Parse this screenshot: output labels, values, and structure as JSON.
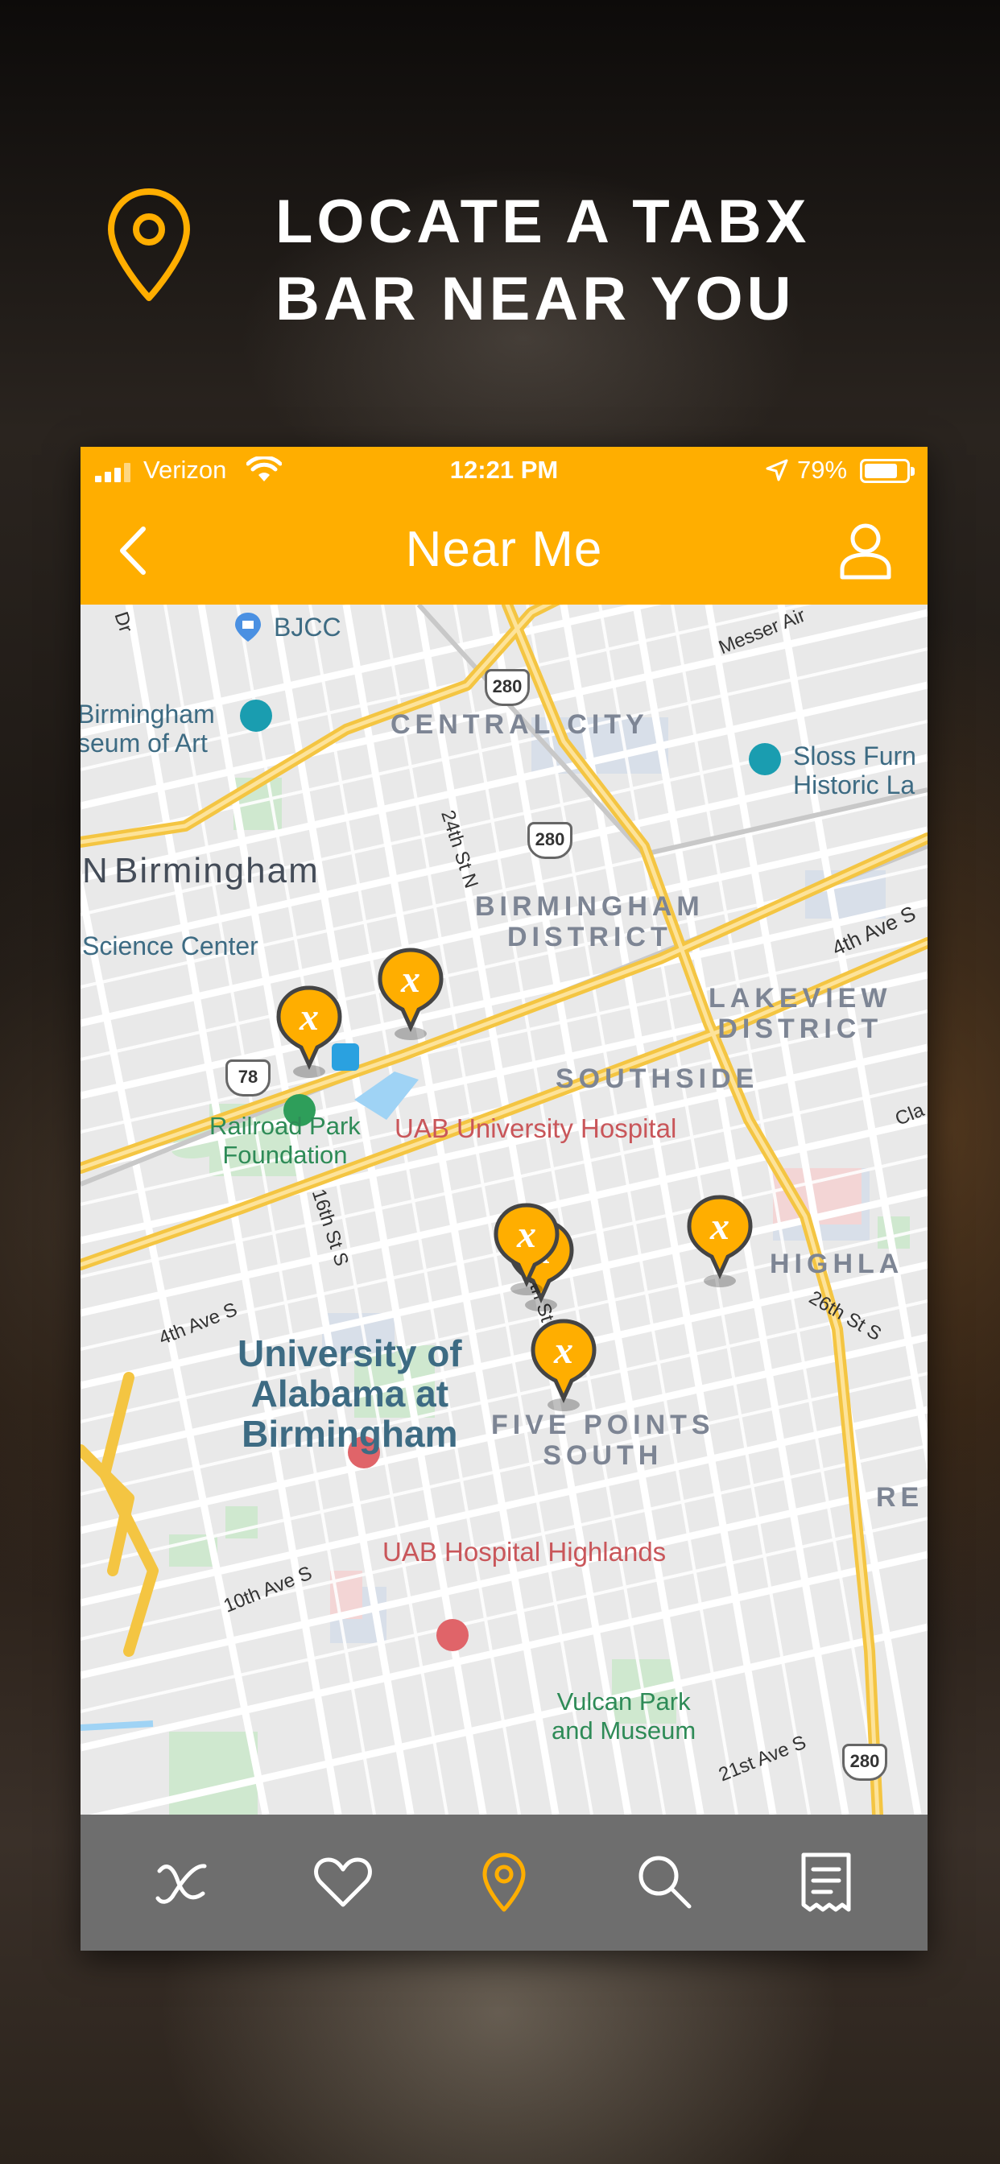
{
  "headline": {
    "text": "LOCATE A TABX\nBAR NEAR YOU",
    "icon": "map-pin-icon"
  },
  "status_bar": {
    "carrier": "Verizon",
    "time": "12:21 PM",
    "battery": "79%",
    "battery_level": 0.79
  },
  "nav": {
    "title": "Near Me",
    "back_icon": "chevron-left-icon",
    "profile_icon": "user-icon"
  },
  "map": {
    "labels": {
      "bjcc": "BJCC",
      "museum_of_art": "Birmingham\nseum of Art",
      "central_city": "CENTRAL CITY",
      "messer": "Messer Air",
      "sloss": "Sloss Furn\nHistoric La",
      "birmingham": "Birmingham",
      "birmingham_n": "N",
      "science_center": "Science Center",
      "birmingham_district": "BIRMINGHAM\nDISTRICT",
      "fourth_ave": "4th Ave S",
      "lakeview": "LAKEVIEW\nDISTRICT",
      "southside": "SOUTHSIDE",
      "railroad_park": "Railroad Park\nFoundation",
      "uab_hospital": "UAB University Hospital",
      "highlands": "HIGHLA",
      "sixteenth": "16th St S",
      "twentieth": "20th St",
      "twentyfourth": "24th St N",
      "twentysixth": "26th St S",
      "fourth_ave_s": "4th Ave S",
      "uab": "University of\nAlabama at\nBirmingham",
      "five_points": "FIVE POINTS\nSOUTH",
      "re": "RE",
      "tenth_ave": "10th Ave S",
      "uab_highlands": "UAB Hospital Highlands",
      "vulcan": "Vulcan Park\nand Museum",
      "twentyfirst": "21st Ave S",
      "clai": "Cla",
      "dr": "Dr"
    },
    "shields": [
      "280",
      "280",
      "78",
      "280"
    ],
    "markers": [
      {
        "label": "x"
      },
      {
        "label": "x"
      },
      {
        "label": "x"
      },
      {
        "label": "x"
      },
      {
        "label": "x"
      },
      {
        "label": "x"
      }
    ]
  },
  "tabs": [
    {
      "name": "home",
      "icon": "tabx-logo-icon",
      "active": false
    },
    {
      "name": "favorites",
      "icon": "heart-icon",
      "active": false
    },
    {
      "name": "near-me",
      "icon": "map-pin-icon",
      "active": true
    },
    {
      "name": "search",
      "icon": "search-icon",
      "active": false
    },
    {
      "name": "receipts",
      "icon": "receipt-icon",
      "active": false
    }
  ],
  "colors": {
    "brand": "#ffae00",
    "tab_bar": "#6e6e6e",
    "active_tab": "#ffae00"
  }
}
